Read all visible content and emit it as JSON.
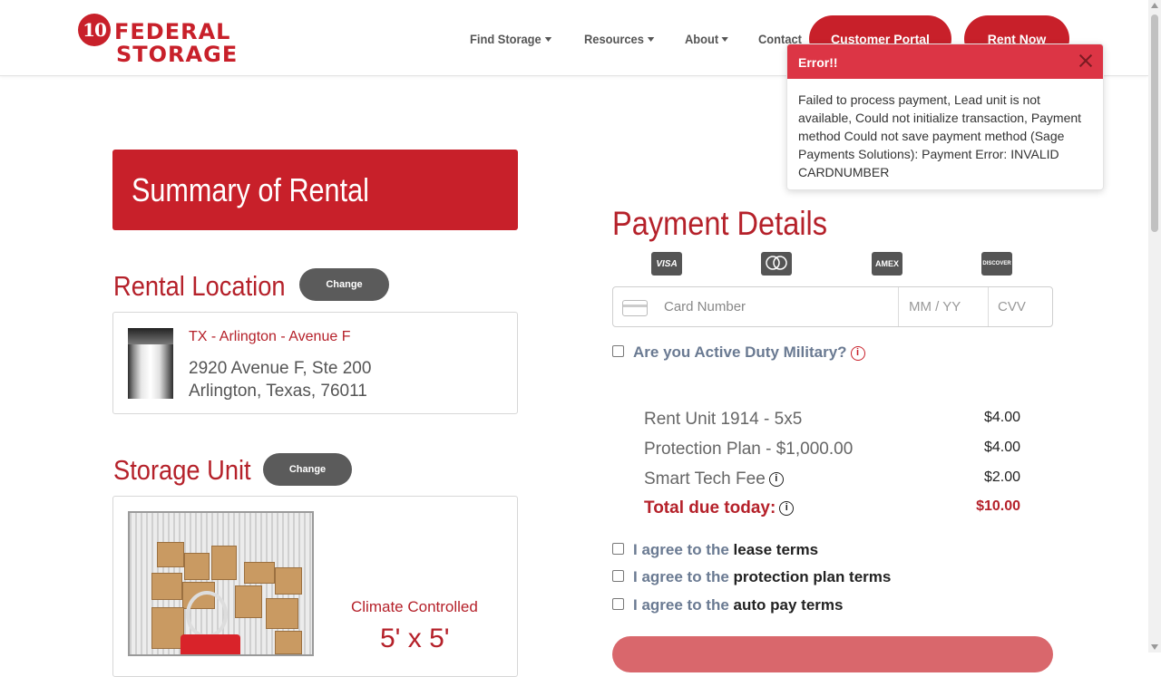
{
  "brand": {
    "logo_number": "10",
    "logo_line1": "FEDERAL",
    "logo_line2": "STORAGE",
    "accent": "#c8202a"
  },
  "nav": {
    "find_storage": "Find Storage",
    "resources": "Resources",
    "about": "About",
    "contact": "Contact",
    "customer_portal": "Customer Portal",
    "rent_now": "Rent Now"
  },
  "toast": {
    "title": "Error!!",
    "message": "Failed to process payment, Lead unit is not available, Could not initialize transaction, Payment method Could not save payment method (Sage Payments Solutions): Payment Error: INVALID CARDNUMBER"
  },
  "summary": {
    "banner": "Summary of Rental"
  },
  "location": {
    "title": "Rental Location",
    "change": "Change",
    "name": "TX - Arlington - Avenue F",
    "address_line1": "2920 Avenue F, Ste 200",
    "address_line2": "Arlington, Texas, 76011"
  },
  "unit": {
    "title": "Storage Unit",
    "change": "Change",
    "type": "Climate Controlled",
    "size": "5' x 5'"
  },
  "payment": {
    "title": "Payment Details",
    "card_brands": [
      "VISA",
      "mastercard",
      "AMEX",
      "DISCOVER"
    ],
    "card_number_placeholder": "Card Number",
    "expiry_placeholder": "MM / YY",
    "cvv_placeholder": "CVV",
    "military_label": "Are you Active Duty Military?",
    "lines": [
      {
        "label": "Rent Unit 1914 - 5x5",
        "amount": "$4.00"
      },
      {
        "label": "Protection Plan - $1,000.00",
        "amount": "$4.00"
      },
      {
        "label": "Smart Tech Fee",
        "amount": "$2.00"
      }
    ],
    "total_label": "Total due today:",
    "total_amount": "$10.00",
    "agree_prefix": "I agree to the",
    "agree_lease": "lease terms",
    "agree_protection": "protection plan terms",
    "agree_autopay": "auto pay terms"
  }
}
